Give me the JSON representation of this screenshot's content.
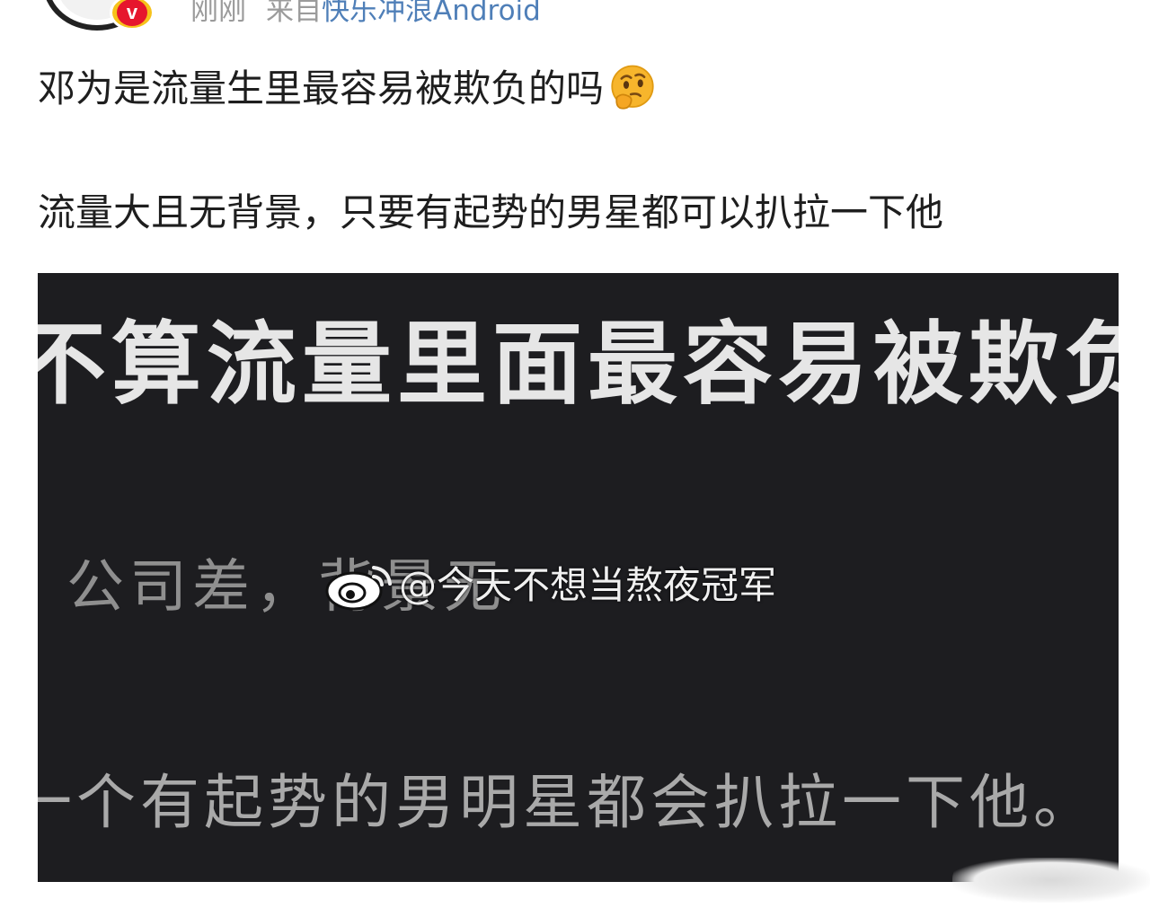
{
  "header": {
    "time": "刚刚",
    "from_label": "来自",
    "client": "快乐冲浪Android",
    "verified_badge_letter": "v"
  },
  "post": {
    "line1": "邓为是流量生里最容易被欺负的吗",
    "line1_emoji": "thinking-face-icon",
    "line2": "流量大且无背景，只要有起势的男星都可以扒拉一下他"
  },
  "image": {
    "heading": "不算流量里面最容易被欺负",
    "company_line": "公司差，背景无",
    "bottom_line": "一个有起势的男明星都会扒拉一下他。",
    "watermark": "@今天不想当熬夜冠军",
    "watermark_icon": "weibo-logo-icon"
  },
  "colors": {
    "client_link": "#4f7fb8",
    "meta_gray": "#9b9b9b",
    "image_bg": "#1d1d20",
    "badge_red": "#e6162d",
    "badge_gold": "#f6c21b"
  }
}
